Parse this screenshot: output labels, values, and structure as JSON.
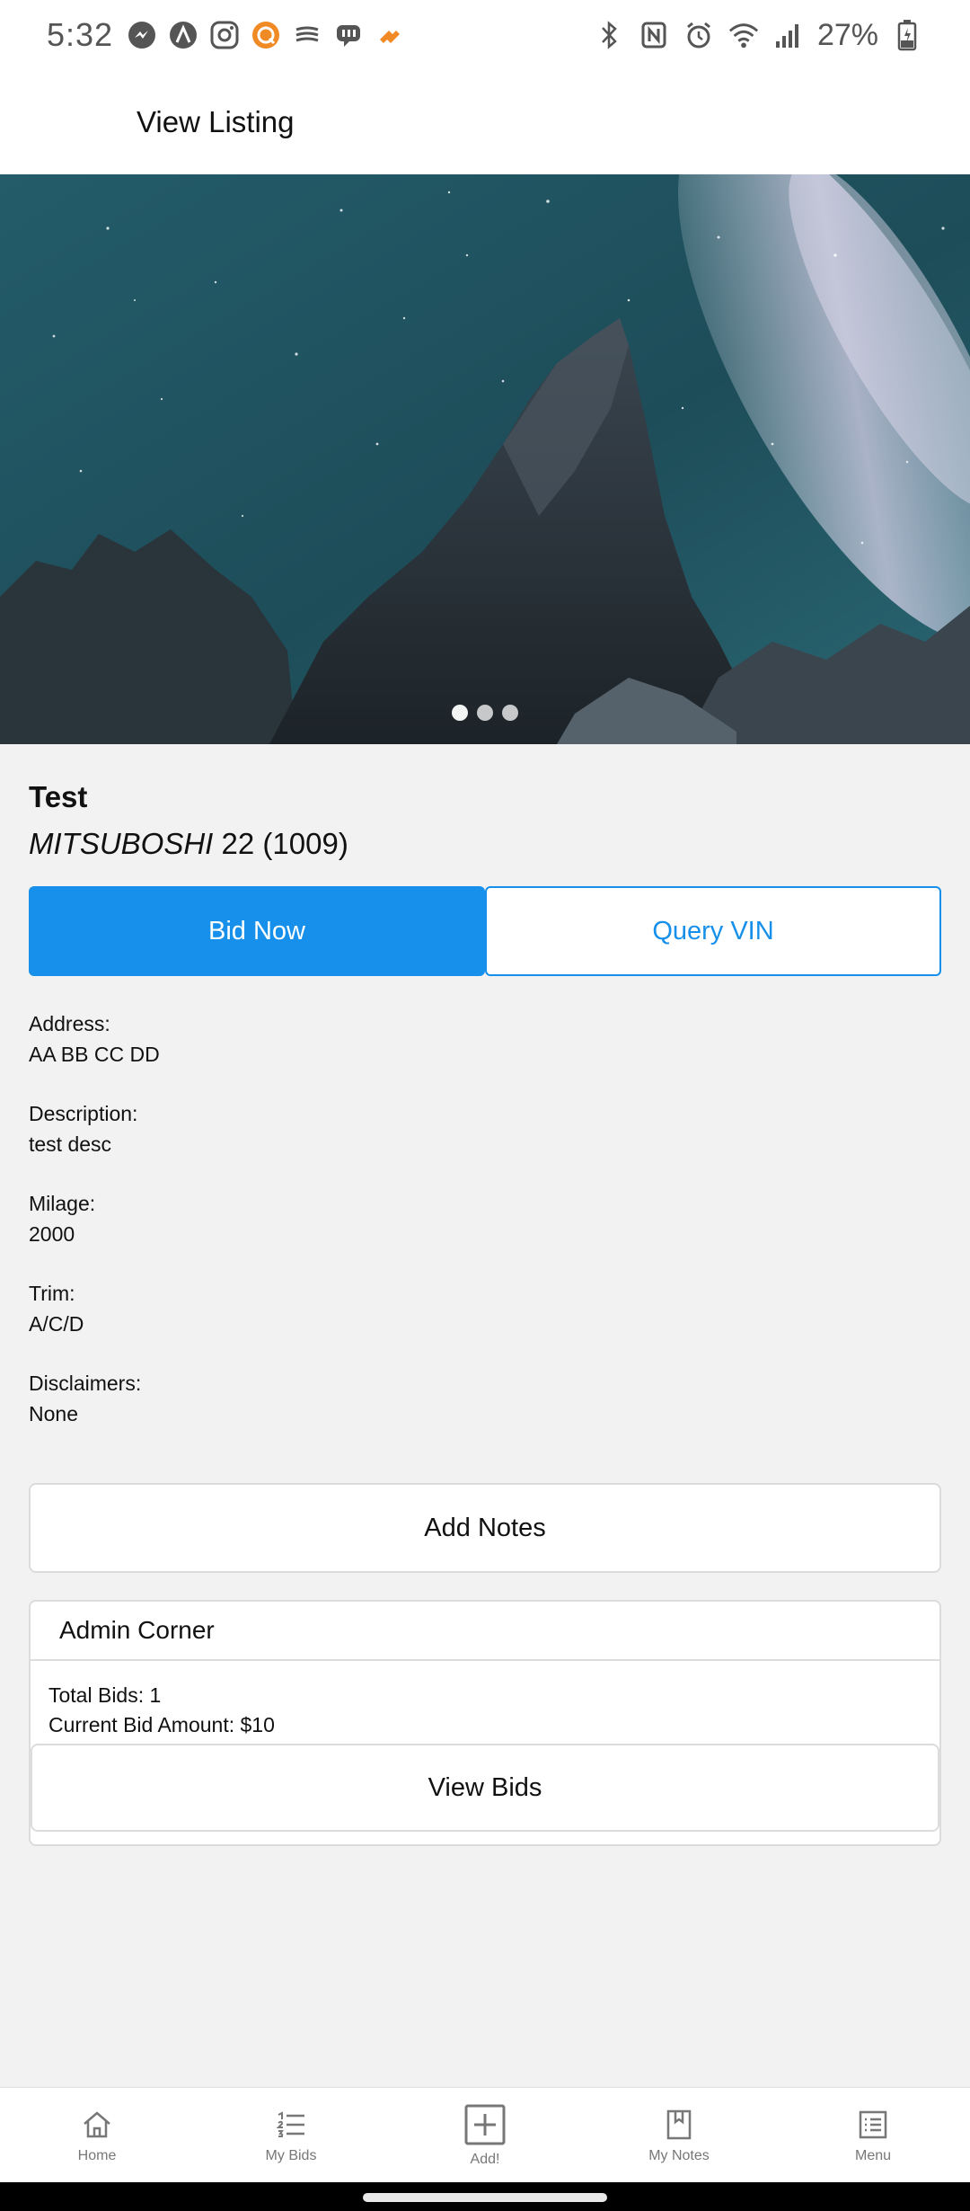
{
  "status_bar": {
    "time": "5:32",
    "battery": "27%"
  },
  "header": {
    "title": "View Listing"
  },
  "hero": {
    "slide_count": 3,
    "active_slide": 0
  },
  "listing": {
    "title": "Test",
    "make": "MITSUBOSHI",
    "year": "22",
    "id": "(1009)"
  },
  "actions": {
    "bid_now": "Bid Now",
    "query_vin": "Query VIN"
  },
  "fields": [
    {
      "label": "Address:",
      "value": "AA BB CC DD"
    },
    {
      "label": "Description:",
      "value": "test desc"
    },
    {
      "label": "Milage:",
      "value": "2000"
    },
    {
      "label": "Trim:",
      "value": "A/C/D"
    },
    {
      "label": "Disclaimers:",
      "value": "None"
    }
  ],
  "add_notes": "Add Notes",
  "admin": {
    "title": "Admin Corner",
    "total_bids": "Total Bids: 1",
    "current_bid": "Current Bid Amount: $10",
    "view_bids": "View Bids"
  },
  "bottom_nav": [
    {
      "label": "Home",
      "icon": "home-icon"
    },
    {
      "label": "My Bids",
      "icon": "list-icon"
    },
    {
      "label": "Add!",
      "icon": "add-icon"
    },
    {
      "label": "My Notes",
      "icon": "bookmark-icon"
    },
    {
      "label": "Menu",
      "icon": "menu-icon"
    }
  ],
  "colors": {
    "accent": "#1690ea",
    "background": "#f2f2f2"
  }
}
